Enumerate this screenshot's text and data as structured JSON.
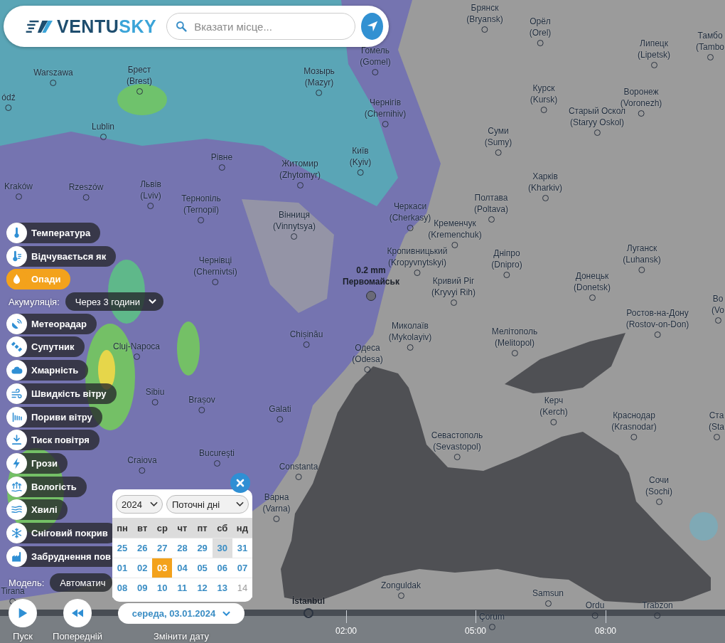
{
  "header": {
    "logo": [
      "VENTU",
      "SKY"
    ],
    "search": {
      "placeholder": "Вказати місце..."
    }
  },
  "cities": [
    {
      "name": "Брянск",
      "latin": "(Bryansk)",
      "major": false
    },
    {
      "name": "Орёл",
      "latin": "(Orel)",
      "major": false
    },
    {
      "name": "Липецк",
      "latin": "(Lipetsk)",
      "major": false
    },
    {
      "name": "Тамбо",
      "latin": "(Tambo",
      "major": false
    },
    {
      "name": "Гомель",
      "latin": "(Gomel)",
      "major": false
    },
    {
      "name": "Warszawa",
      "major": false
    },
    {
      "name": "Брест",
      "latin": "(Brest)",
      "major": false
    },
    {
      "name": "Мозырь",
      "latin": "(Mazyr)",
      "major": false
    },
    {
      "name": "ódź",
      "major": false
    },
    {
      "name": "Lublin",
      "major": false
    },
    {
      "name": "Чернігів",
      "latin": "(Chernihiv)",
      "major": false
    },
    {
      "name": "Курск",
      "latin": "(Kursk)",
      "major": false
    },
    {
      "name": "Воронеж",
      "latin": "(Voronezh)",
      "major": false
    },
    {
      "name": "Старый Оскол",
      "latin": "(Staryy Oskol)",
      "major": false
    },
    {
      "name": "Київ",
      "latin": "(Kyiv)",
      "major": false
    },
    {
      "name": "Суми",
      "latin": "(Sumy)",
      "major": false
    },
    {
      "name": "Рівне",
      "major": false
    },
    {
      "name": "Житомир",
      "latin": "(Zhytomyr)",
      "major": false
    },
    {
      "name": "Kraków",
      "major": false
    },
    {
      "name": "Rzeszów",
      "major": false
    },
    {
      "name": "Львів",
      "latin": "(Lviv)",
      "major": false
    },
    {
      "name": "Харків",
      "latin": "(Kharkiv)",
      "major": false
    },
    {
      "name": "Тернопіль",
      "latin": "(Ternopil)",
      "major": false
    },
    {
      "name": "Вінниця",
      "latin": "(Vinnytsya)",
      "major": false
    },
    {
      "name": "Черкаси",
      "latin": "(Cherkasy)",
      "major": false
    },
    {
      "name": "Полтава",
      "latin": "(Poltava)",
      "major": false
    },
    {
      "name": "Кременчук",
      "latin": "(Kremenchuk)",
      "major": false
    },
    {
      "name": "Чернівці",
      "latin": "(Chernivtsi)",
      "major": false
    },
    {
      "name": "Кропивницький",
      "latin": "(Kropyvnytskyi)",
      "major": false
    },
    {
      "name": "Дніпро",
      "latin": "(Dnipro)",
      "major": false
    },
    {
      "name": "Луганск",
      "latin": "(Luhansk)",
      "major": false
    },
    {
      "name": "Кривий Ріг",
      "latin": "(Kryvyi Rih)",
      "major": false
    },
    {
      "name": "Донецьк",
      "latin": "(Donetsk)",
      "major": false
    },
    {
      "name": "Chișinău",
      "major": false
    },
    {
      "name": "Миколаїв",
      "latin": "(Mykolayiv)",
      "major": false
    },
    {
      "name": "Мелітополь",
      "latin": "(Melitopol)",
      "major": false
    },
    {
      "name": "Ростов-на-Дону",
      "latin": "(Rostov-on-Don)",
      "major": false
    },
    {
      "name": "Во",
      "latin": "(Vo",
      "major": false
    },
    {
      "name": "Cluj-Napoca",
      "major": false
    },
    {
      "name": "Одеса",
      "latin": "(Odesa)",
      "major": false
    },
    {
      "name": "Sibiu",
      "major": false
    },
    {
      "name": "Brașov",
      "major": false
    },
    {
      "name": "Galati",
      "major": false
    },
    {
      "name": "Керч",
      "latin": "(Kerch)",
      "major": false
    },
    {
      "name": "Краснодар",
      "latin": "(Krasnodar)",
      "major": false
    },
    {
      "name": "Ста",
      "latin": "(Sta",
      "major": false
    },
    {
      "name": "Craiova",
      "major": false
    },
    {
      "name": "Bucureşti",
      "major": false
    },
    {
      "name": "Constanta",
      "major": false
    },
    {
      "name": "Севастополь",
      "latin": "(Sevastopol)",
      "major": false
    },
    {
      "name": "Варна",
      "latin": "(Varna)",
      "major": false
    },
    {
      "name": "Сочи",
      "latin": "(Sochi)",
      "major": false
    },
    {
      "name": "Tirana",
      "major": false
    },
    {
      "name": "İstanbul",
      "major": true
    },
    {
      "name": "Zonguldak",
      "major": false
    },
    {
      "name": "Samsun",
      "major": false
    },
    {
      "name": "Ordu",
      "major": false
    },
    {
      "name": "Trabzon",
      "major": false
    },
    {
      "name": "Çorum",
      "major": false
    }
  ],
  "point_forecast": {
    "value": "0.2 mm",
    "place": "Первомайськ"
  },
  "layers": [
    {
      "label": "Температура",
      "selected": false
    },
    {
      "label": "Відчувається як",
      "selected": false
    },
    {
      "label": "Опади",
      "selected": true,
      "option": {
        "label": "Акумуляція:",
        "value": "Через 3 години"
      }
    },
    {
      "label": "Метеорадар",
      "selected": false
    },
    {
      "label": "Супутник",
      "selected": false
    },
    {
      "label": "Хмарність",
      "selected": false
    },
    {
      "label": "Швидкість вітру",
      "selected": false
    },
    {
      "label": "Пориви вітру",
      "selected": false
    },
    {
      "label": "Тиск повітря",
      "selected": false
    },
    {
      "label": "Грози",
      "selected": false
    },
    {
      "label": "Вологість",
      "selected": false
    },
    {
      "label": "Хвилі",
      "selected": false
    },
    {
      "label": "Сніговий покрив",
      "selected": false
    },
    {
      "label": "Забруднення пов",
      "selected": false
    }
  ],
  "model": {
    "label": "Модель:",
    "value": "Автоматич"
  },
  "calendar": {
    "year": "2024",
    "range": "Поточні дні",
    "weekdays": [
      "пн",
      "вт",
      "ср",
      "чт",
      "пт",
      "сб",
      "нд"
    ],
    "weeks": [
      [
        {
          "day": "25",
          "selected": false,
          "disabled": false,
          "highlighted": false
        },
        {
          "day": "26",
          "selected": false,
          "disabled": false,
          "highlighted": false
        },
        {
          "day": "27",
          "selected": false,
          "disabled": false,
          "highlighted": false
        },
        {
          "day": "28",
          "selected": false,
          "disabled": false,
          "highlighted": false
        },
        {
          "day": "29",
          "selected": false,
          "disabled": false,
          "highlighted": false
        },
        {
          "day": "30",
          "selected": false,
          "disabled": false,
          "highlighted": true
        },
        {
          "day": "31",
          "selected": false,
          "disabled": false,
          "highlighted": false
        }
      ],
      [
        {
          "day": "01",
          "selected": false,
          "disabled": false,
          "highlighted": false
        },
        {
          "day": "02",
          "selected": false,
          "disabled": false,
          "highlighted": false
        },
        {
          "day": "03",
          "selected": true,
          "disabled": false,
          "highlighted": false
        },
        {
          "day": "04",
          "selected": false,
          "disabled": false,
          "highlighted": false
        },
        {
          "day": "05",
          "selected": false,
          "disabled": false,
          "highlighted": false
        },
        {
          "day": "06",
          "selected": false,
          "disabled": false,
          "highlighted": false
        },
        {
          "day": "07",
          "selected": false,
          "disabled": false,
          "highlighted": false
        }
      ],
      [
        {
          "day": "08",
          "selected": false,
          "disabled": false,
          "highlighted": false
        },
        {
          "day": "09",
          "selected": false,
          "disabled": false,
          "highlighted": false
        },
        {
          "day": "10",
          "selected": false,
          "disabled": false,
          "highlighted": false
        },
        {
          "day": "11",
          "selected": false,
          "disabled": false,
          "highlighted": false
        },
        {
          "day": "12",
          "selected": false,
          "disabled": false,
          "highlighted": false
        },
        {
          "day": "13",
          "selected": false,
          "disabled": false,
          "highlighted": false
        },
        {
          "day": "14",
          "selected": false,
          "disabled": true,
          "highlighted": false
        }
      ]
    ]
  },
  "playback": {
    "play_label": "Пуск",
    "previous_label": "Попередній",
    "date": "середа, 03.01.2024",
    "date_label": "Змінити дату"
  },
  "timeline": {
    "ticks": [
      "02:00",
      "05:00",
      "08:00"
    ]
  }
}
